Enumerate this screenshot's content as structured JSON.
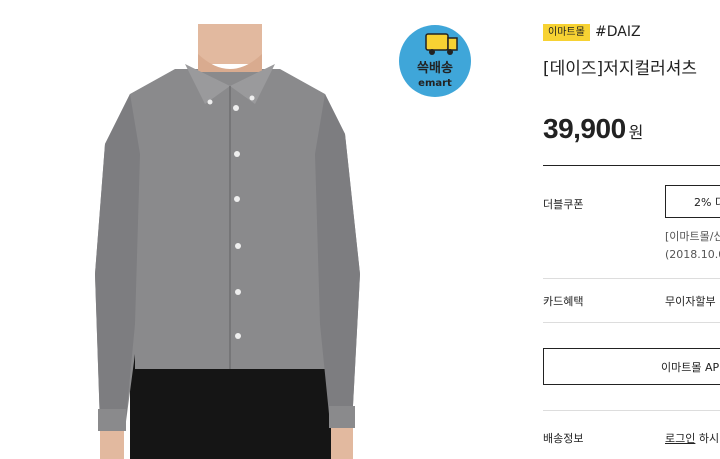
{
  "delivery_badge": {
    "text_top": "쓱배송",
    "text_bottom": "emart"
  },
  "product": {
    "store_badge": "이마트몰",
    "brand_tag": "#DAIZ",
    "title": "[데이즈]저지컬러셔츠",
    "price": "39,900",
    "price_unit": "원"
  },
  "double_coupon": {
    "label": "더블쿠폰",
    "button": "2% 더",
    "note_line1": "[이마트몰/신",
    "note_line2": "(2018.10.0"
  },
  "card_benefit": {
    "label": "카드혜택",
    "value": "무이자할부"
  },
  "app_button": "이마트몰 AP",
  "shipping": {
    "label": "배송정보",
    "login_link": "로그인",
    "rest": " 하시"
  },
  "colors": {
    "badge_yellow": "#f7d233",
    "shirt_gray": "#8a8a8c",
    "badge_blue": "#3fa6d9"
  },
  "icons": [
    "delivery-truck-icon"
  ]
}
